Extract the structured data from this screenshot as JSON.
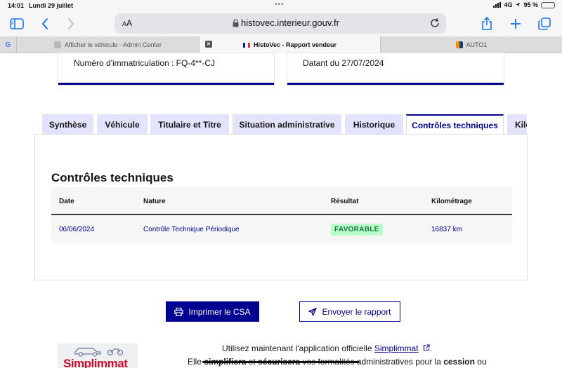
{
  "status_bar": {
    "time": "14:01",
    "date": "Lundi 29 juillet",
    "network": "4G",
    "battery": "95 %"
  },
  "browser": {
    "address_aa": "AA",
    "url": "histovec.interieur.gouv.fr",
    "tabs": [
      {
        "label": "Afficher le véhicule - Admin Center"
      },
      {
        "label": "HistoVec - Rapport vendeur"
      },
      {
        "label": "AUTO1"
      }
    ]
  },
  "vehicle_card": {
    "plate_text": "Numéro d'immatriculation : FQ-4**-CJ"
  },
  "report_card": {
    "date_text": "Datant du 27/07/2024"
  },
  "report_tabs": [
    {
      "label": "Synthèse"
    },
    {
      "label": "Véhicule"
    },
    {
      "label": "Titulaire et Titre"
    },
    {
      "label": "Situation administrative"
    },
    {
      "label": "Historique"
    },
    {
      "label": "Contrôles techniques"
    },
    {
      "label": "Kilo"
    }
  ],
  "section": {
    "title": "Contrôles techniques"
  },
  "table": {
    "headers": [
      "Date",
      "Nature",
      "Résultat",
      "Kilométrage"
    ],
    "rows": [
      {
        "date": "06/06/2024",
        "nature": "Contrôle Technique Périodique",
        "result": "FAVORABLE",
        "mileage": "16837 km"
      }
    ]
  },
  "actions": {
    "print_label": "Imprimer le CSA",
    "send_label": "Envoyer le rapport"
  },
  "promo": {
    "logo_text": "Simplimmat",
    "line1_prefix": "Utilisez maintenant l'application officielle",
    "line1_link": "Simplimmat",
    "line2_a": "Elle",
    "line2_b": "simplifiera",
    "line2_c": "et",
    "line2_d": "sécurisera",
    "line2_e": "vos formalités administratives pour la",
    "line2_f": "cession",
    "line2_g": "ou"
  },
  "colors": {
    "accent": "#000091",
    "tab_bg": "#e3e3fd",
    "success_bg": "#b8fec9",
    "success_text": "#18753c"
  }
}
